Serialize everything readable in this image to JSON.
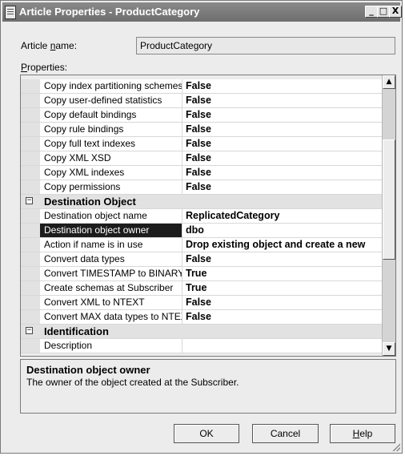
{
  "window": {
    "title": "Article Properties - ProductCategory",
    "controls": [
      "_",
      "□",
      "X"
    ]
  },
  "article_name": {
    "label_pre": "Article ",
    "label_key": "n",
    "label_post": "ame:",
    "value": "ProductCategory"
  },
  "properties_label": {
    "key": "P",
    "rest": "roperties:"
  },
  "grid": {
    "rows": [
      {
        "type": "prop",
        "name": "Copy index partitioning schemes",
        "value": "False"
      },
      {
        "type": "prop",
        "name": "Copy user-defined statistics",
        "value": "False"
      },
      {
        "type": "prop",
        "name": "Copy default bindings",
        "value": "False"
      },
      {
        "type": "prop",
        "name": "Copy rule bindings",
        "value": "False"
      },
      {
        "type": "prop",
        "name": "Copy full text indexes",
        "value": "False"
      },
      {
        "type": "prop",
        "name": "Copy XML XSD",
        "value": "False"
      },
      {
        "type": "prop",
        "name": "Copy XML indexes",
        "value": "False"
      },
      {
        "type": "prop",
        "name": "Copy permissions",
        "value": "False"
      },
      {
        "type": "cat",
        "name": "Destination Object",
        "expander": "−"
      },
      {
        "type": "prop",
        "name": "Destination object name",
        "value": "ReplicatedCategory"
      },
      {
        "type": "prop",
        "name": "Destination object owner",
        "value": "dbo",
        "selected": true
      },
      {
        "type": "prop",
        "name": "Action if name is in use",
        "value": "Drop existing object and create a new"
      },
      {
        "type": "prop",
        "name": "Convert data types",
        "value": "False"
      },
      {
        "type": "prop",
        "name": "Convert TIMESTAMP to BINARY",
        "value": "True"
      },
      {
        "type": "prop",
        "name": "Create schemas at Subscriber",
        "value": "True"
      },
      {
        "type": "prop",
        "name": "Convert XML to NTEXT",
        "value": "False"
      },
      {
        "type": "prop",
        "name": "Convert MAX data types to NTEXT",
        "value": "False"
      },
      {
        "type": "cat",
        "name": "Identification",
        "expander": "−"
      },
      {
        "type": "prop",
        "name": "Description",
        "value": ""
      }
    ]
  },
  "scrollbar": {
    "up": "▲",
    "down": "▼"
  },
  "description": {
    "title": "Destination object owner",
    "text": "The owner of the object created at the Subscriber."
  },
  "buttons": {
    "ok": "OK",
    "cancel": "Cancel",
    "help_key": "H",
    "help_rest": "elp"
  }
}
